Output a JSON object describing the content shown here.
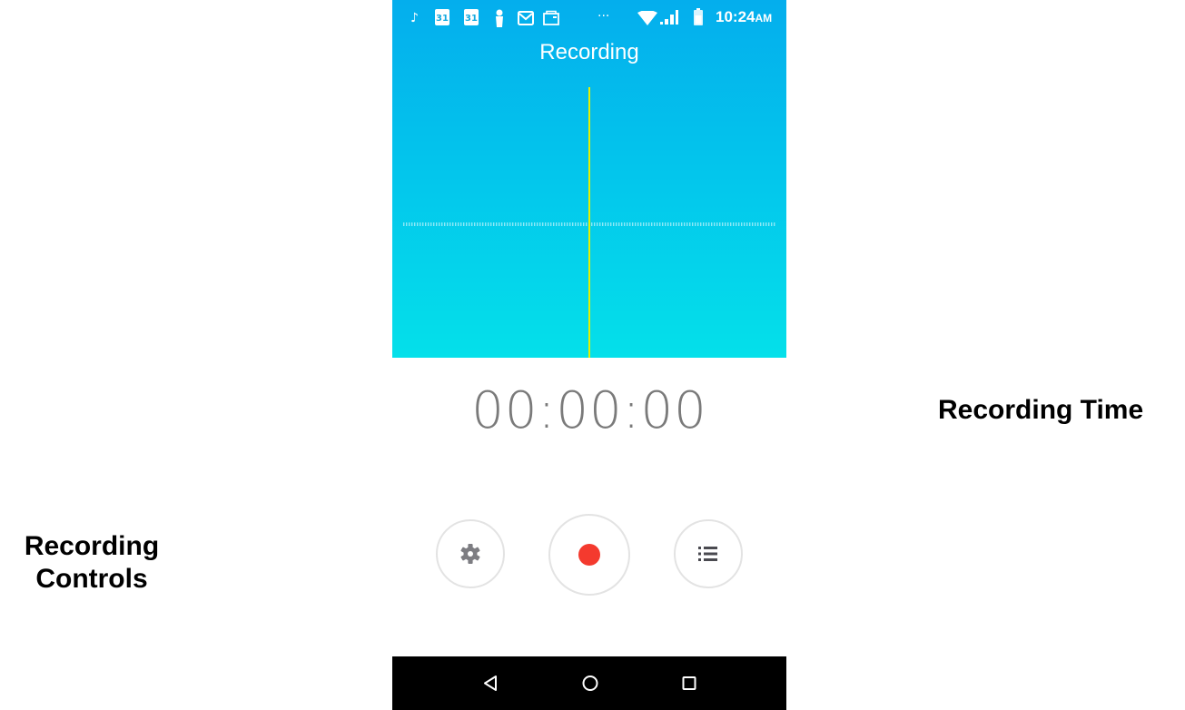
{
  "status_bar": {
    "icons": [
      "music-note-icon",
      "calendar-icon",
      "calendar-icon",
      "person-icon",
      "gmail-icon",
      "folder-icon",
      "more-dots-icon",
      "wifi-icon",
      "signal-icon",
      "battery-icon"
    ],
    "calendar_day": "31",
    "more": "···",
    "time": "10:24",
    "ampm": "AM"
  },
  "app": {
    "title": "Recording",
    "timer": "00:00:00"
  },
  "controls": {
    "settings_icon": "gear-icon",
    "record_icon": "record-icon",
    "list_icon": "list-icon",
    "record_color": "#f43a2e"
  },
  "nav": {
    "back_icon": "back-triangle-icon",
    "home_icon": "home-circle-icon",
    "recents_icon": "recents-square-icon"
  },
  "annotations": {
    "recording_time": "Recording Time",
    "recording_controls_line1": "Recording",
    "recording_controls_line2": "Controls"
  },
  "colors": {
    "header_top": "#04aeed",
    "header_bottom": "#04e0ea",
    "playhead": "#e6f000"
  }
}
